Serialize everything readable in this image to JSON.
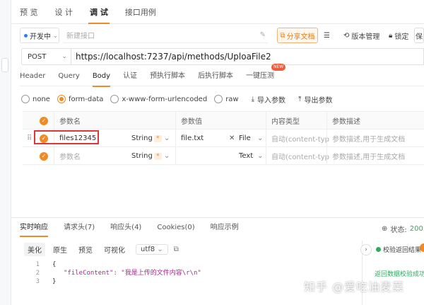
{
  "top_tabs": [
    "预 览",
    "设 计",
    "调 试",
    "接口用例"
  ],
  "env": {
    "label": "开发中"
  },
  "api_name_placeholder": "新建接口",
  "toolbar": {
    "share": "分享文档",
    "version": "版本管理",
    "lock": "锁定",
    "extra": "保"
  },
  "request": {
    "method": "POST",
    "url": "https://localhost:7237/api/methods/UploaFile2"
  },
  "request_tabs": [
    "Header",
    "Query",
    "Body",
    "认证",
    "预执行脚本",
    "后执行脚本",
    "一键压测"
  ],
  "new_badge": "NEW",
  "body_types": [
    "none",
    "form-data",
    "x-www-form-urlencoded",
    "raw"
  ],
  "body_actions": {
    "import": "导入参数",
    "export": "导出参数"
  },
  "table": {
    "headers": [
      "参数名",
      "参数值",
      "内容类型",
      "参数描述"
    ],
    "rows": [
      {
        "name": "files12345",
        "type": "String",
        "value": "file.txt",
        "value_type": "File",
        "content_type": "自动(content-typ",
        "desc": "参数描述,用于生成文档"
      },
      {
        "name": "参数名",
        "type": "String",
        "value": "",
        "value_type": "Text",
        "content_type": "自动(content-typ",
        "desc": "参数描述,用于生成文档"
      }
    ]
  },
  "response_tabs": [
    "实时响应",
    "请求头(7)",
    "响应头(4)",
    "Cookies(0)",
    "响应示例"
  ],
  "status": {
    "label": "状态:",
    "value": "200"
  },
  "format_buttons": [
    "美化",
    "原生",
    "预览",
    "可视化"
  ],
  "encoding": "utf8",
  "code_lines": [
    "{",
    "\"fileContent\": \"我是上传的文件内容\\r\\n\"",
    "}"
  ],
  "verify": {
    "label": "校验返回结果",
    "message": "返回数据校验成功"
  },
  "watermark": "知乎 @爱吃油麦菜"
}
